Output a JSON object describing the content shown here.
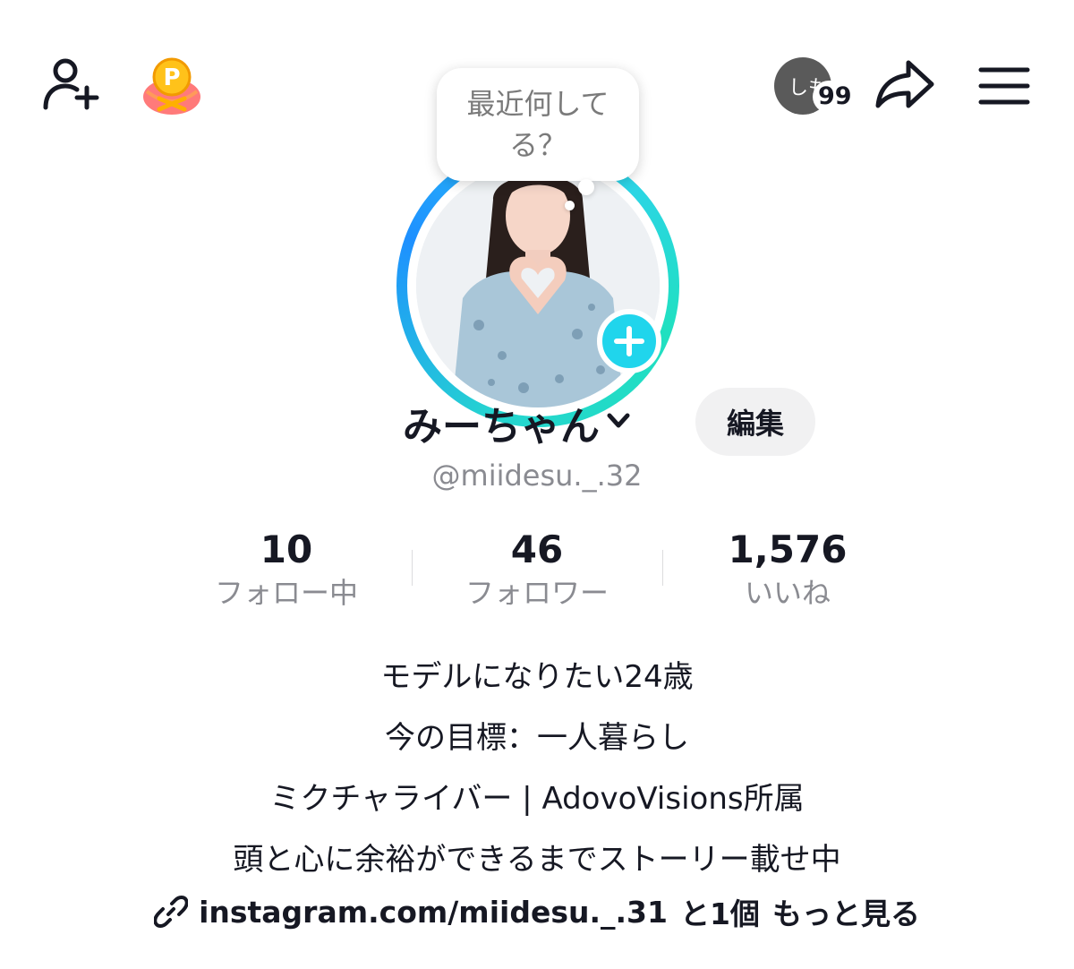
{
  "header": {
    "activity_preview_text": "しも",
    "activity_count": "99"
  },
  "status_bubble": {
    "text": "最近何してる？"
  },
  "profile": {
    "display_name": "みーちゃん",
    "edit_label": "編集",
    "username": "@miidesu._.32"
  },
  "stats": {
    "following": {
      "value": "10",
      "label": "フォロー中"
    },
    "followers": {
      "value": "46",
      "label": "フォロワー"
    },
    "likes": {
      "value": "1,576",
      "label": "いいね"
    }
  },
  "bio": {
    "lines": [
      "モデルになりたい24歳",
      "今の目標：一人暮らし",
      "ミクチャライバー | AdovoVisions所属",
      "頭と心に余裕ができるまでストーリー載せ中"
    ],
    "link": "instagram.com/miidesu._.31",
    "link_extra": "と1個",
    "more_label": "もっと見る"
  },
  "icons": {
    "add_friend": "add-friend-icon",
    "points": "points-bag-icon",
    "share": "share-arrow-icon",
    "menu": "hamburger-menu-icon",
    "link": "link-chain-icon",
    "chevron": "chevron-down-icon",
    "add_story": "plus-icon"
  },
  "colors": {
    "accent_cyan": "#20d5ec",
    "ring_blue": "#1e90ff",
    "text_primary": "#161823",
    "text_secondary": "#8a8b91",
    "button_bg": "#f1f1f2",
    "activity_avatar": "#5a5a5a"
  }
}
